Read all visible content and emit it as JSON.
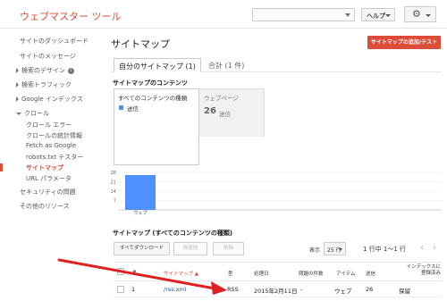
{
  "header": {
    "app_title": "ウェブマスター ツール",
    "help_label": "ヘルプ",
    "gear_icon": "gear-icon"
  },
  "sidebar": {
    "items": [
      {
        "label": "サイトのダッシュボード"
      },
      {
        "label": "サイトのメッセージ"
      },
      {
        "label": "検索のデザイン"
      },
      {
        "label": "検索トラフィック"
      },
      {
        "label": "Google インデックス"
      },
      {
        "label": "クロール"
      },
      {
        "label": "クロール エラー"
      },
      {
        "label": "クロールの統計情報"
      },
      {
        "label": "Fetch as Google"
      },
      {
        "label": "robots.txt テスター"
      },
      {
        "label": "サイトマップ"
      },
      {
        "label": "URL パラメータ"
      },
      {
        "label": "セキュリティの問題"
      },
      {
        "label": "その他のリソース"
      }
    ],
    "info_glyph": "i",
    "active_color": "#dd4b39"
  },
  "main": {
    "title": "サイトマップ",
    "add_button": "サイトマップの追加/テスト",
    "tabs": [
      {
        "label": "自分のサイトマップ (1)"
      },
      {
        "label": "合計 (1 件)"
      }
    ],
    "content_section_title": "サイトマップのコンテンツ",
    "legend": {
      "heading": "すべてのコンテンツの種類",
      "series_label": "送信",
      "series_color": "#4d90fe"
    },
    "stat": {
      "heading": "ウェブページ",
      "value": "26",
      "label": "送信"
    },
    "table_title": "サイトマップ (すべてのコンテンツの種類)",
    "toolbar": {
      "download": "すべてダウンロード",
      "resend": "再送信",
      "delete": "削除",
      "show_label": "表示",
      "rows_value": "25 行",
      "page_info": "1 行中 1〜1 行"
    },
    "columns": {
      "num": "#",
      "sitemap": "サイトマップ ▲",
      "type": "型",
      "processed": "処理日",
      "issues": "問題の件数",
      "items": "アイテム",
      "submitted": "送信",
      "indexed_line1": "インデックスに",
      "indexed_line2": "登録済み"
    },
    "rows": [
      {
        "num": "1",
        "sitemap": "/rss.xml",
        "type": "RSS",
        "processed": "2015年2月11日",
        "issues": "-",
        "items": "ウェブ",
        "submitted": "26",
        "indexed": "保留"
      }
    ]
  },
  "chart_data": {
    "type": "bar",
    "categories": [
      "ウェブ"
    ],
    "series": [
      {
        "name": "送信",
        "values": [
          26
        ]
      }
    ],
    "y_ticks": [
      28,
      21,
      14,
      7
    ],
    "ylim": [
      0,
      28
    ],
    "bar_color": "#4d90fe",
    "grid": true
  },
  "annotation": {
    "arrow_color": "#e02020"
  }
}
